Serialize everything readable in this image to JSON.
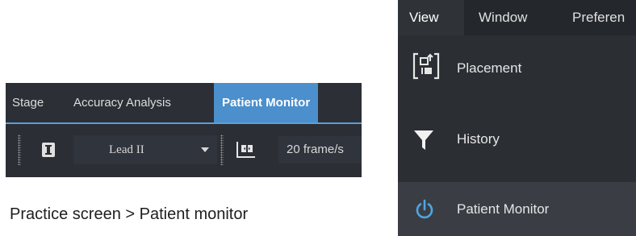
{
  "left_panel": {
    "tabs": [
      {
        "label": "Stage"
      },
      {
        "label": "Accuracy Analysis"
      },
      {
        "label": "Patient Monitor",
        "active": true
      }
    ],
    "toolbar": {
      "lead_select": "Lead II",
      "frame_rate": "20 frame/s"
    }
  },
  "caption": "Practice screen > Patient monitor",
  "right_panel": {
    "menu": [
      {
        "label": "View",
        "active": true
      },
      {
        "label": "Window"
      },
      {
        "label": "Preferen"
      }
    ],
    "items": [
      {
        "label": "Placement",
        "icon": "placement-icon"
      },
      {
        "label": "History",
        "icon": "filter-icon"
      },
      {
        "label": "Patient Monitor",
        "icon": "power-icon",
        "highlighted": true
      }
    ]
  },
  "colors": {
    "accent": "#4b8fcc",
    "panel_bg": "#2b2e33",
    "power_icon": "#4ea6e0"
  }
}
